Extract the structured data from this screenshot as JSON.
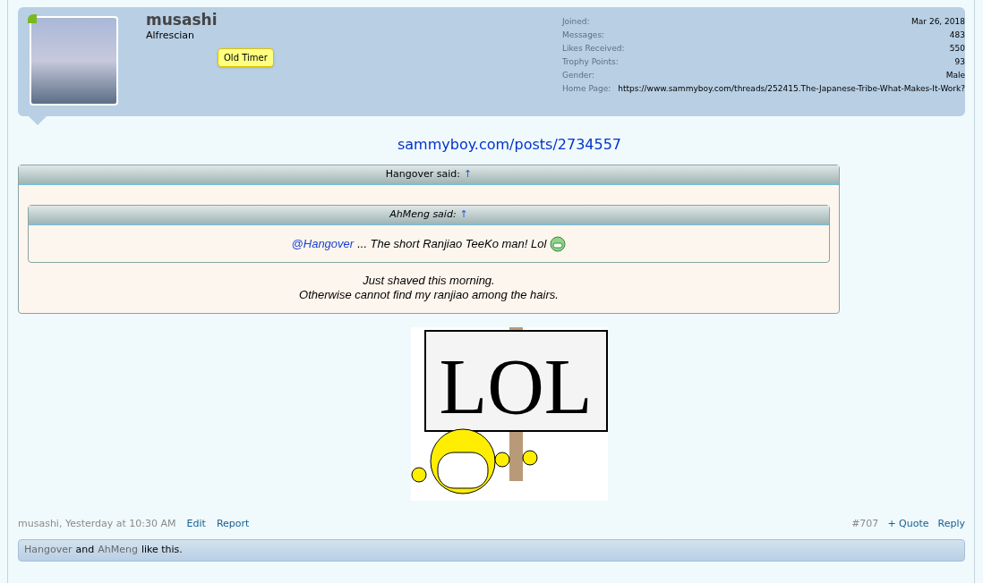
{
  "user": {
    "name": "musashi",
    "title": "Alfrescian",
    "badge": "Old Timer",
    "online": true,
    "stats": [
      {
        "label": "Joined:",
        "value": "Mar 26, 2018"
      },
      {
        "label": "Messages:",
        "value": "483"
      },
      {
        "label": "Likes Received:",
        "value": "550"
      },
      {
        "label": "Trophy Points:",
        "value": "93"
      },
      {
        "label": "Gender:",
        "value": "Male"
      }
    ],
    "home_page": {
      "label": "Home Page:",
      "value": "https://www.sammyboy.com/threads/252415.The-Japanese-Tribe-What-Makes-It-Work?"
    }
  },
  "post": {
    "link": "sammyboy.com/posts/2734557",
    "quote": {
      "author": "Hangover said:",
      "arrow": "↑",
      "nested": {
        "author": "AhMeng said:",
        "arrow": "↑",
        "mention": "@Hangover",
        "text": "... The short Ranjiao TeeKo man! Lol"
      },
      "lines": [
        "Just shaved this morning.",
        "Otherwise cannot find my ranjiao among the hairs."
      ]
    },
    "image_text": "LOL"
  },
  "footer": {
    "meta": "musashi, Yesterday at 10:30 AM",
    "actions": [
      "Edit",
      "Report"
    ],
    "number": "#707",
    "right_actions": [
      "+ Quote",
      "Reply"
    ]
  },
  "likes": {
    "users": [
      "Hangover",
      "AhMeng"
    ],
    "joiner": "and",
    "suffix": "like this."
  }
}
